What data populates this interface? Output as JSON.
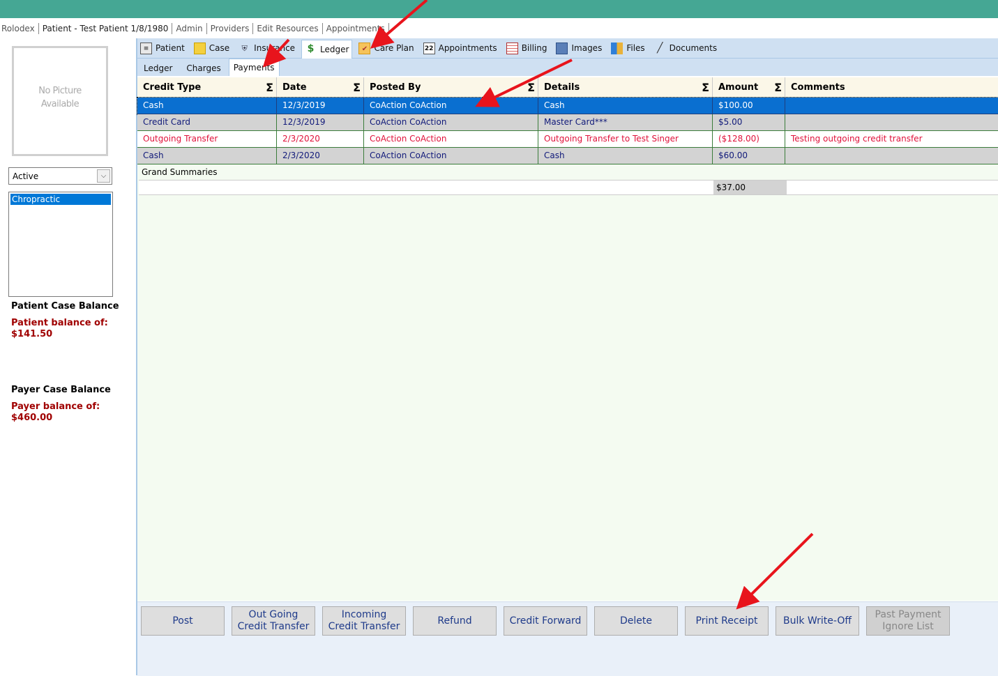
{
  "nav": {
    "items": [
      "Rolodex",
      "Patient - Test Patient 1/8/1980",
      "Admin",
      "Providers",
      "Edit Resources",
      "Appointments"
    ]
  },
  "left": {
    "photo_placeholder_line1": "No Picture",
    "photo_placeholder_line2": "Available",
    "status_value": "Active",
    "cases": [
      "Chropractic"
    ],
    "patient_case_balance_title": "Patient Case Balance",
    "patient_balance_label": "Patient balance of:",
    "patient_balance_value": "$141.50",
    "payer_case_balance_title": "Payer Case Balance",
    "payer_balance_label": "Payer balance of:",
    "payer_balance_value": "$460.00"
  },
  "tabs": [
    {
      "label": "Patient",
      "icon": "patient-card-icon"
    },
    {
      "label": "Case",
      "icon": "case-folder-icon"
    },
    {
      "label": "Insurance",
      "icon": "insurance-shield-icon"
    },
    {
      "label": "Ledger",
      "icon": "ledger-money-icon"
    },
    {
      "label": "Care Plan",
      "icon": "care-plan-icon"
    },
    {
      "label": "Appointments",
      "icon": "calendar-icon"
    },
    {
      "label": "Billing",
      "icon": "billing-icon"
    },
    {
      "label": "Images",
      "icon": "images-icon"
    },
    {
      "label": "Files",
      "icon": "files-icon"
    },
    {
      "label": "Documents",
      "icon": "documents-pen-icon"
    }
  ],
  "subtabs": [
    "Ledger",
    "Charges",
    "Payments"
  ],
  "grid": {
    "columns": [
      "Credit Type",
      "Date",
      "Posted By",
      "Details",
      "Amount",
      "Comments"
    ],
    "rows": [
      {
        "credit_type": "Cash",
        "date": "12/3/2019",
        "posted_by": "CoAction CoAction",
        "details": "Cash",
        "amount": "$100.00",
        "comments": ""
      },
      {
        "credit_type": "Credit Card",
        "date": "12/3/2019",
        "posted_by": "CoAction CoAction",
        "details": "Master Card***",
        "amount": "$5.00",
        "comments": ""
      },
      {
        "credit_type": "Outgoing Transfer",
        "date": "2/3/2020",
        "posted_by": "CoAction CoAction",
        "details": "Outgoing Transfer to Test Singer",
        "amount": "($128.00)",
        "comments": "Testing outgoing credit transfer"
      },
      {
        "credit_type": "Cash",
        "date": "2/3/2020",
        "posted_by": "CoAction CoAction",
        "details": "Cash",
        "amount": "$60.00",
        "comments": ""
      }
    ],
    "grand_summaries_label": "Grand Summaries",
    "grand_total": "$37.00"
  },
  "actions": {
    "post": "Post",
    "outgoing_1": "Out Going",
    "outgoing_2": "Credit Transfer",
    "incoming_1": "Incoming",
    "incoming_2": "Credit Transfer",
    "refund": "Refund",
    "credit_forward": "Credit Forward",
    "delete": "Delete",
    "print_receipt": "Print Receipt",
    "bulk_write_off": "Bulk Write-Off",
    "past_payment_1": "Past Payment",
    "past_payment_2": "Ignore List"
  },
  "colors": {
    "header_bar": "#45a794",
    "selection": "#0a6fd0",
    "negative_text": "#e0113a",
    "annotation_arrow": "#e8141c"
  }
}
